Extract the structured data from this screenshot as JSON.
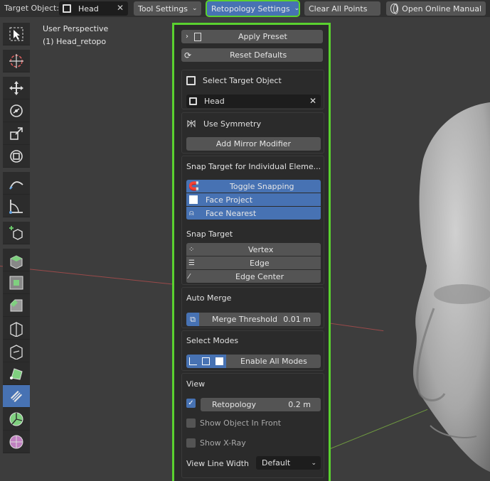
{
  "header": {
    "target_label": "Target Object:",
    "target_value": "Head",
    "tool_settings": "Tool Settings",
    "retopo_settings": "Retopology Settings",
    "clear_points": "Clear All Points",
    "open_manual": "Open Online Manual"
  },
  "viewport": {
    "perspective": "User Perspective",
    "object": "(1) Head_retopo"
  },
  "panel": {
    "apply_preset": "Apply Preset",
    "reset_defaults": "Reset Defaults",
    "select_target": "Select Target Object",
    "target_value": "Head",
    "use_symmetry": "Use Symmetry",
    "add_mirror": "Add Mirror Modifier",
    "snap_individual_title": "Snap Target for Individual Eleme...",
    "toggle_snapping": "Toggle Snapping",
    "face_project": "Face Project",
    "face_nearest": "Face Nearest",
    "snap_target_title": "Snap Target",
    "vertex": "Vertex",
    "edge": "Edge",
    "edge_center": "Edge Center",
    "auto_merge": "Auto Merge",
    "merge_threshold": "Merge Threshold",
    "merge_value": "0.01 m",
    "select_modes": "Select Modes",
    "enable_all_modes": "Enable All Modes",
    "view_title": "View",
    "retopology_label": "Retopology",
    "retopology_value": "0.2 m",
    "show_in_front": "Show Object In Front",
    "show_xray": "Show X-Ray",
    "line_width_label": "View Line Width",
    "line_width_value": "Default"
  },
  "colors": {
    "accent": "#4772b3",
    "highlight_border": "#5ad12f",
    "panel_bg": "#2b2b2b",
    "viewport_bg": "#3d3d3d"
  }
}
